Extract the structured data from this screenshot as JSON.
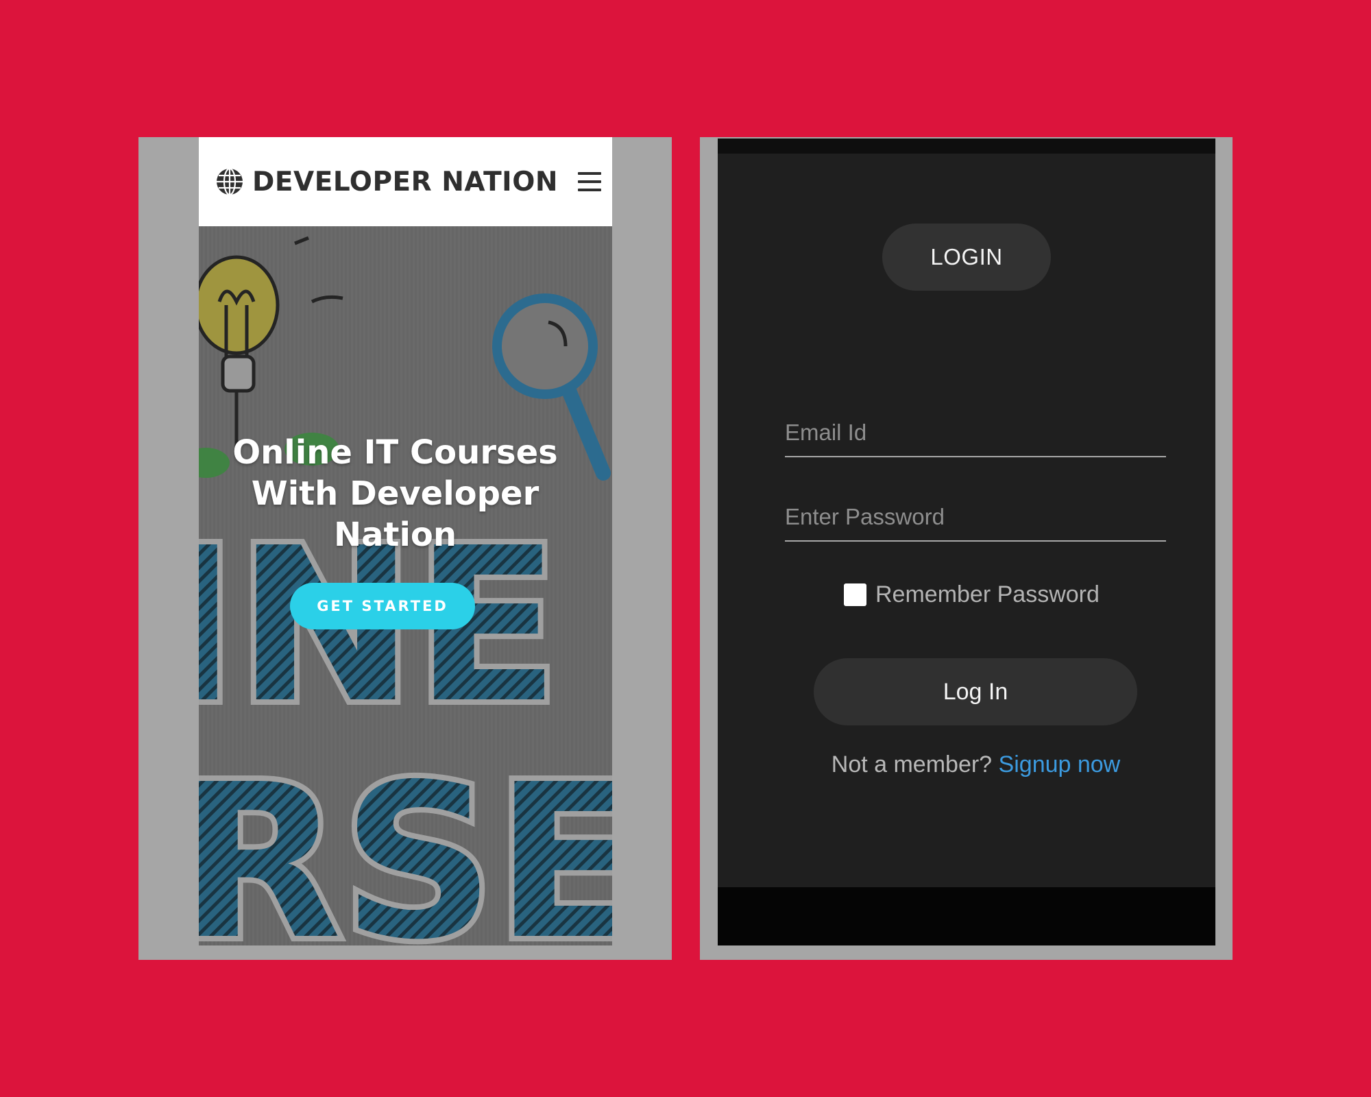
{
  "colors": {
    "background": "#dc143c",
    "frame": "#a6a6a6",
    "accent_cyan": "#2bd0e8",
    "link_blue": "#3c9be0",
    "dark_panel": "#1f1f1f"
  },
  "left_screen": {
    "nav": {
      "logo_icon": "globe-icon",
      "brand": "DEVELOPER NATION",
      "menu_icon": "hamburger-menu-icon"
    },
    "hero": {
      "title_lines": [
        "Online IT Courses",
        "With Developer",
        "Nation"
      ],
      "cta_label": "GET STARTED"
    }
  },
  "right_screen": {
    "header_label": "LOGIN",
    "email": {
      "placeholder": "Email Id",
      "value": ""
    },
    "password": {
      "placeholder": "Enter Password",
      "value": ""
    },
    "remember": {
      "label": "Remember Password",
      "checked": false
    },
    "login_button": "Log In",
    "signup_prompt": "Not a member?",
    "signup_link": "Signup now"
  }
}
